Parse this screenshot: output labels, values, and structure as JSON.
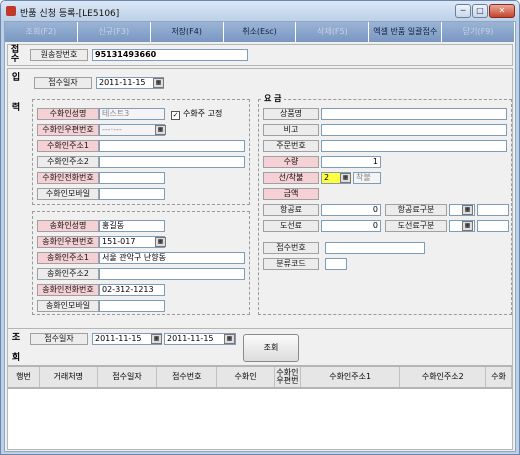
{
  "window": {
    "title": "반품 신청 등록-[LE5106]",
    "min": "─",
    "max": "□",
    "close": "✕"
  },
  "toolbar": [
    {
      "label": "조회(F2)",
      "enabled": false
    },
    {
      "label": "신규(F3)",
      "enabled": false
    },
    {
      "label": "저장(F4)",
      "enabled": true
    },
    {
      "label": "취소(Esc)",
      "enabled": true
    },
    {
      "label": "삭제(F5)",
      "enabled": false
    },
    {
      "label": "엑셀 반품 일괄접수",
      "enabled": true
    },
    {
      "label": "닫기(F9)",
      "enabled": false
    }
  ],
  "jeopsu": {
    "side_label": "접수",
    "waybill_label": "원송장번호",
    "waybill_value": "95131493660"
  },
  "input": {
    "side_label": "입\n\n\n력",
    "receipt_date_label": "접수일자",
    "receipt_date_value": "2011-11-15",
    "recipient": {
      "name_label": "수화인성명",
      "name_value": "테스트3",
      "fix_checkbox_label": "수화주 고정",
      "fix_checked": true,
      "postcode_label": "수화인우편번호",
      "postcode_value": "---·---",
      "addr1_label": "수화인주소1",
      "addr1_value": "",
      "addr2_label": "수화인주소2",
      "addr2_value": "",
      "phone_label": "수화인전화번호",
      "phone_value": "",
      "mobile_label": "수화인모바일",
      "mobile_value": ""
    },
    "sender": {
      "name_label": "송화인성명",
      "name_value": "홍길동",
      "postcode_label": "송화인우편번호",
      "postcode_value": "151-017",
      "addr1_label": "송화인주소1",
      "addr1_value": "서울 관악구 난향동",
      "addr2_label": "송화인주소2",
      "addr2_value": "",
      "phone_label": "송화인전화번호",
      "phone_value": "02-312-1213",
      "mobile_label": "송화인모바일",
      "mobile_value": ""
    },
    "charges": {
      "heading": "요    금",
      "product_label": "상품명",
      "product_value": "",
      "note_label": "비고",
      "note_value": "",
      "order_label": "주문번호",
      "order_value": "",
      "qty_label": "수량",
      "qty_value": "1",
      "prepaid_label": "선/착불",
      "prepaid_code": "2",
      "prepaid_text": "착불",
      "amount_label": "금액",
      "amount_value": "",
      "air_fee_label": "항공료",
      "air_fee_value": "0",
      "air_type_label": "항공료구분",
      "air_type_value": "",
      "ferry_fee_label": "도선료",
      "ferry_fee_value": "0",
      "ferry_type_label": "도선료구분",
      "ferry_type_value": "",
      "recv_no_label": "접수번호",
      "recv_no_value": "",
      "class_code_label": "분류코드",
      "class_code_value": ""
    }
  },
  "query": {
    "side_label": "조\n\n회",
    "date_label": "접수일자",
    "date_from": "2011-11-15",
    "date_to": "2011-11-15",
    "search_button": "조회"
  },
  "grid": {
    "columns": [
      "행번",
      "거래처명",
      "접수일자",
      "접수번호",
      "수화인",
      "수화인\n우편번",
      "수화인주소1",
      "수화인주소2",
      "수화"
    ]
  }
}
